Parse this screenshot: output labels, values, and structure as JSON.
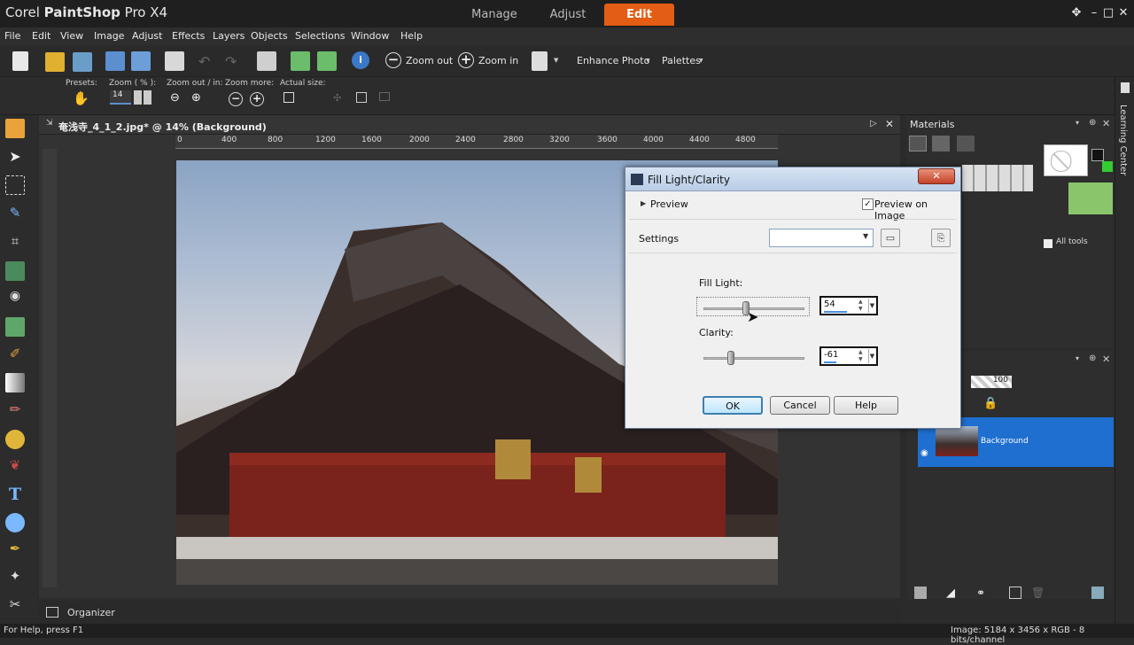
{
  "app": {
    "title_light": "Corel ",
    "title_bold": "PaintShop",
    "title_rest": " Pro X4"
  },
  "workspace_tabs": [
    "Manage",
    "Adjust",
    "Edit"
  ],
  "menu": [
    "File",
    "Edit",
    "View",
    "Image",
    "Adjust",
    "Effects",
    "Layers",
    "Objects",
    "Selections",
    "Window",
    "Help"
  ],
  "toolbar": {
    "zoom_out": "Zoom out",
    "zoom_in": "Zoom in",
    "enhance_photo": "Enhance Photo",
    "palettes": "Palettes"
  },
  "options": {
    "presets": "Presets:",
    "zoom_pct": "Zoom ( % ):",
    "zoom_value": "14",
    "zoom_out_in": "Zoom out / in:",
    "zoom_more": "Zoom more:",
    "actual_size": "Actual size:"
  },
  "document": {
    "title": "奄浅寺_4_1_2.jpg* @  14% (Background)"
  },
  "ruler": [
    "0",
    "400",
    "800",
    "1200",
    "1600",
    "2000",
    "2400",
    "2800",
    "3200",
    "3600",
    "4000",
    "4400",
    "4800"
  ],
  "materials": {
    "title": "Materials",
    "all_tools": "All tools"
  },
  "layers": {
    "opacity": "100",
    "layer_name": "Background"
  },
  "dialog": {
    "title": "Fill Light/Clarity",
    "preview": "Preview",
    "preview_on_image": "Preview on Image",
    "settings": "Settings",
    "fill_light_label": "Fill Light:",
    "fill_light_value": "54",
    "clarity_label": "Clarity:",
    "clarity_value": "-61",
    "ok": "OK",
    "cancel": "Cancel",
    "help": "Help"
  },
  "organizer": "Organizer",
  "learning_center": "Learning Center",
  "status": {
    "left": "For Help, press F1",
    "right": "Image:  5184 x 3456 x RGB - 8 bits/channel"
  }
}
